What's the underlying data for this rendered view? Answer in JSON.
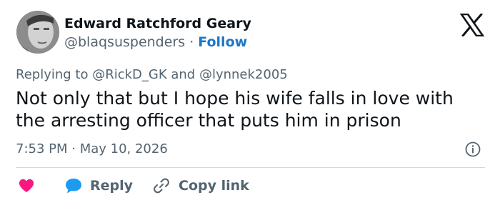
{
  "tweet": {
    "author": {
      "name": "Edward Ratchford Geary",
      "handle": "@blaqsuspenders",
      "separator": "·",
      "follow_label": "Follow",
      "avatar_icon": "profile-photo"
    },
    "brand_icon": "x-logo-icon",
    "replying_to": "Replying to @RickD_GK and @lynnek2005",
    "text": "Not only that but I hope his wife falls in love with the arresting officer that puts him in prison",
    "timestamp": "7:53 PM · May 10, 2026",
    "info_icon": "info-icon",
    "actions": {
      "like_icon": "heart-icon",
      "reply_icon": "speech-bubble-icon",
      "reply_label": "Reply",
      "copy_icon": "link-icon",
      "copy_label": "Copy link"
    }
  },
  "colors": {
    "text": "#0f1419",
    "secondary": "#536471",
    "follow": "#1d77c9",
    "heart": "#f91880",
    "reply_bubble": "#1d9bf0",
    "divider": "#cfd9de"
  }
}
